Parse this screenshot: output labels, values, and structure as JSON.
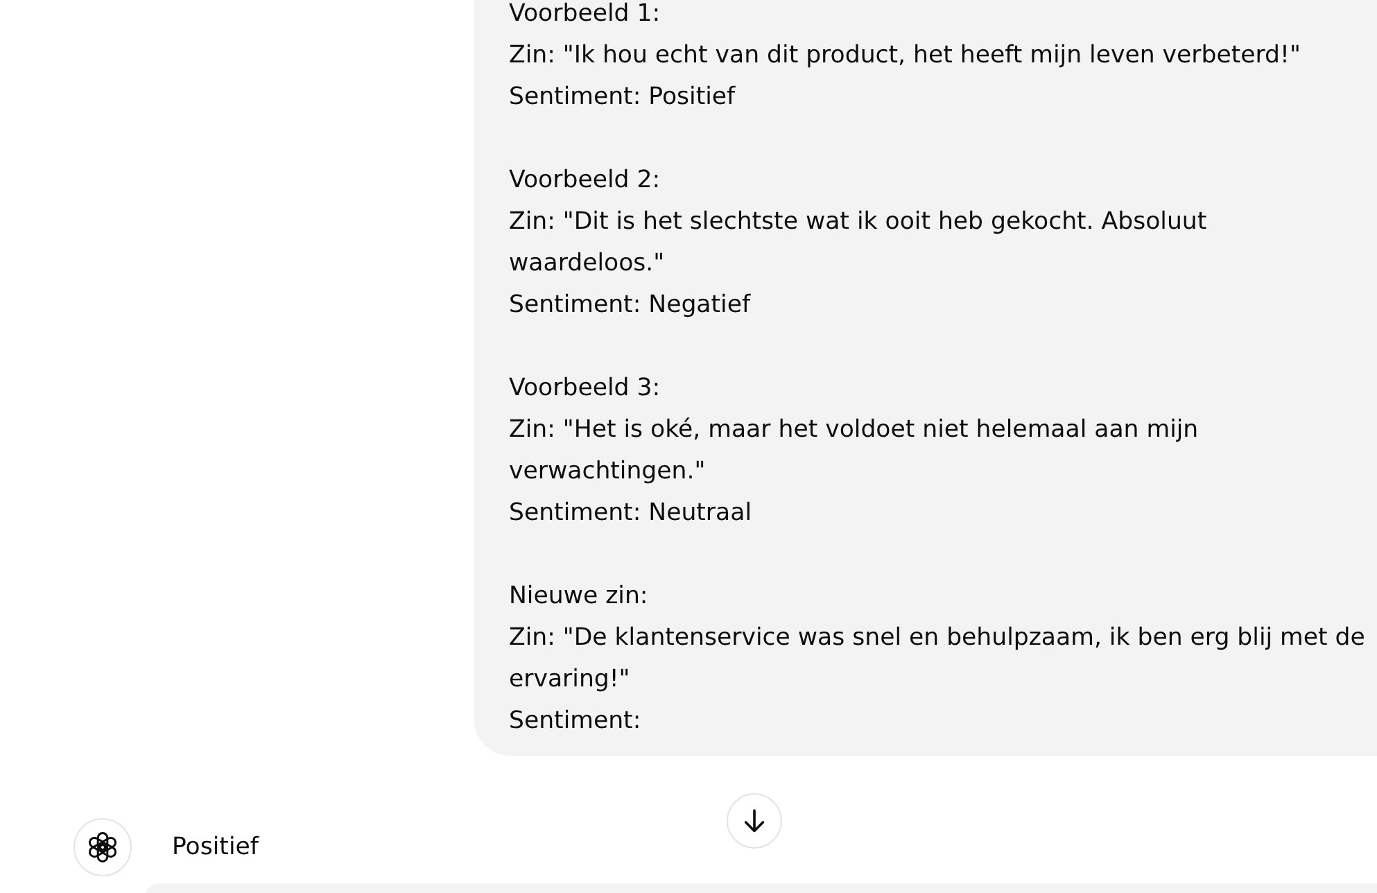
{
  "user_message": {
    "blocks": [
      {
        "lines": [
          "Voorbeeld 1:",
          "Zin: \"Ik hou echt van dit product, het heeft mijn leven verbeterd!\"",
          "Sentiment: Positief"
        ]
      },
      {
        "lines": [
          "Voorbeeld 2:",
          "Zin: \"Dit is het slechtste wat ik ooit heb gekocht. Absoluut waardeloos.\"",
          "Sentiment: Negatief"
        ]
      },
      {
        "lines": [
          "Voorbeeld 3:",
          "Zin: \"Het is oké, maar het voldoet niet helemaal aan mijn verwachtingen.\"",
          "Sentiment: Neutraal"
        ]
      },
      {
        "lines": [
          "Nieuwe zin:",
          "Zin: \"De klantenservice was snel en behulpzaam, ik ben erg blij met de ervaring!\"",
          "Sentiment:"
        ]
      }
    ]
  },
  "assistant_message": {
    "text": "Positief"
  }
}
